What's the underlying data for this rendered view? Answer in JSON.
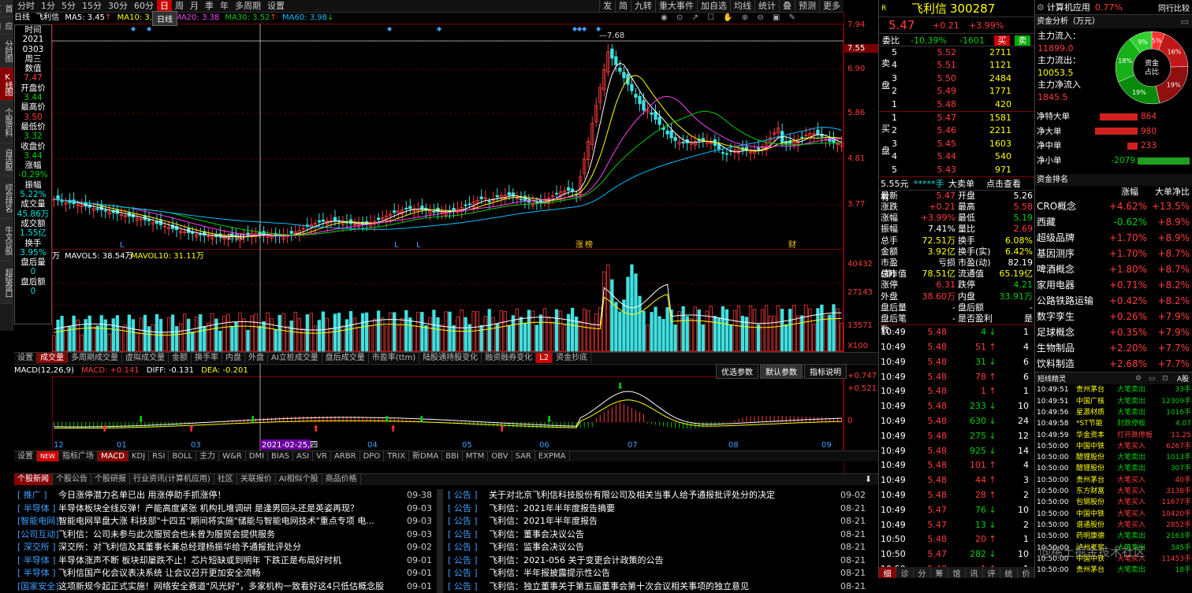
{
  "left_tabs": [
    "首页",
    "应用",
    "分时图",
    "K线图",
    "个股资料",
    "自选股",
    "综合排名",
    "牛叉诊股",
    "超级盘口"
  ],
  "left_tabs_active": 3,
  "periods": [
    "分时",
    "1分",
    "5分",
    "15分",
    "30分",
    "60分",
    "日",
    "周",
    "月",
    "季",
    "年",
    "多周期",
    "设置"
  ],
  "period_active": "日",
  "toolbar_right": [
    "发",
    "简",
    "九转",
    "重大事件",
    "加自选",
    "均线",
    "统计",
    "叠",
    "预测",
    "更多"
  ],
  "ma_line": {
    "label": "日线",
    "name": "飞利信",
    "ma5": "MA5: 3.45",
    "ma10": "MA10: 3.27",
    "ma20": "MA20: 3.38",
    "ma30": "MA30: 3.52",
    "ma60": "MA60: 3.98"
  },
  "tooltip": "日线",
  "infobox": [
    {
      "k": "时间",
      "v": "2021",
      "c": "wh"
    },
    {
      "k": "",
      "v": "0303",
      "c": "wh"
    },
    {
      "k": "",
      "v": "周三",
      "c": "wh"
    },
    {
      "k": "数值",
      "v": "7.47",
      "c": "red"
    },
    {
      "k": "开盘价",
      "v": "3.44",
      "c": "green"
    },
    {
      "k": "最高价",
      "v": "3.50",
      "c": "red"
    },
    {
      "k": "最低价",
      "v": "3.32",
      "c": "green"
    },
    {
      "k": "收盘价",
      "v": "3.44",
      "c": "green"
    },
    {
      "k": "涨幅",
      "v": "-0.29%",
      "c": "green"
    },
    {
      "k": "振幅",
      "v": "5.22%",
      "c": "cy"
    },
    {
      "k": "成交量",
      "v": "45.86万",
      "c": "cy"
    },
    {
      "k": "成交额",
      "v": "1.55亿",
      "c": "cy"
    },
    {
      "k": "换手",
      "v": "3.95%",
      "c": "cy"
    },
    {
      "k": "盘后量",
      "v": "0",
      "c": "cy"
    },
    {
      "k": "盘后额",
      "v": "0",
      "c": "cy"
    }
  ],
  "price_axis": [
    "7.94",
    "7.55",
    "6.90",
    "5.86",
    "4.81",
    "3.77"
  ],
  "price_hi_label": "7.68",
  "price_lo_label": "2.98",
  "chart_markers": [
    "L",
    "L",
    "L",
    "涨",
    "榜",
    "财"
  ],
  "vol_line": {
    "unit": "万",
    "mavol5": "MAVOL5: 38.54万",
    "mavol10": "MAVOL10: 31.11万"
  },
  "vol_axis": [
    "40432",
    "27143",
    "13571",
    "X100"
  ],
  "ind_tabs1": [
    "设置",
    "成交量",
    "多周期成交量",
    "虚拟成交量",
    "金额",
    "换手率",
    "内盘",
    "外盘",
    "AI立桩成交量",
    "盘后成交量",
    "市盈率(ttm)",
    "陆股通持股变化",
    "融资融券变化",
    "L2",
    "资金抄底"
  ],
  "ind_tabs1_active": 1,
  "macd_line": {
    "label": "MACD(12,26,9)",
    "macd": "MACD: +0.141",
    "diff": "DIFF: -0.131",
    "dea": "DEA: -0.201"
  },
  "macd_buttons": [
    "优选参数",
    "默认参数",
    "指标说明"
  ],
  "macd_axis": [
    "+0.747",
    "+0.521",
    "0"
  ],
  "date_axis": [
    "12",
    "01",
    "03",
    "04",
    "05",
    "06",
    "07",
    "08",
    "09"
  ],
  "date_cursor": "2021-02-25,四",
  "ind_tabs2": [
    "设置",
    "NEW",
    "指标广场",
    "MACD",
    "KDJ",
    "RSI",
    "BOLL",
    "主力",
    "W&R",
    "DMI",
    "BIAS",
    "ASI",
    "VR",
    "ARBR",
    "DPO",
    "TRIX",
    "新DMA",
    "BBI",
    "MTM",
    "OBV",
    "SAR",
    "EXPMA"
  ],
  "ind_tabs2_active": 3,
  "news_tabs": [
    "个股新闻",
    "个股公告",
    "个股研报",
    "行业资讯(计算机应用)",
    "社区",
    "关联报价",
    "AI相似个股",
    "商品价格"
  ],
  "news_left": [
    {
      "tag": "[ 推广 ]",
      "title": "今日涨停潜力名单已出 用涨停助手抓涨停！",
      "date": "09-38"
    },
    {
      "tag": "[ 半导体 ]",
      "title": "半导体板块全线反弹！产能高度紧张 机构扎堆调研 是逢男回头还是英姿再现？",
      "date": "09-03"
    },
    {
      "tag": "[智能电网]",
      "title": "智能电网旱盘大涨  科技部\"十四五\"期间将实施\"储能与智能电网技术\"重点专项  电...",
      "date": "09-03"
    },
    {
      "tag": "[公司互动]",
      "title": "飞利信：公司未参与此次服贸会也未曾为服贸会提供服务",
      "date": "09-03"
    },
    {
      "tag": "[ 深交所 ]",
      "title": "深交所：对飞利信及其董事长兼总经理杨振华给予通报批评处分",
      "date": "09-02"
    },
    {
      "tag": "[ 半导体 ]",
      "title": "半导体涨声不断 板块却屡跌不止！芯片短缺或到明年 下跌正是布局好时机",
      "date": "09-01"
    },
    {
      "tag": "[ 半导体 ]",
      "title": "飞利信国产化会议表决系统 让会议召开更加安全流畅",
      "date": "09-01"
    },
    {
      "tag": "[国家安全]",
      "title": "这项新规今起正式实施！网络安全赛道\"风光好\"，多家机构一致看好这4只低估概念股",
      "date": "09-01"
    }
  ],
  "news_right": [
    {
      "tag": "[ 公告 ]",
      "title": "关于对北京飞利信科技股份有限公司及相关当事人给予通报批评处分的决定",
      "date": "09-02"
    },
    {
      "tag": "[ 公告 ]",
      "title": "飞利信：2021年半年度报告摘要",
      "date": "08-21"
    },
    {
      "tag": "[ 公告 ]",
      "title": "飞利信：2021年半年度报告",
      "date": "08-21"
    },
    {
      "tag": "[ 公告 ]",
      "title": "飞利信：董事会决议公告",
      "date": "08-21"
    },
    {
      "tag": "[ 公告 ]",
      "title": "飞利信：监事会决议公告",
      "date": "08-21"
    },
    {
      "tag": "[ 公告 ]",
      "title": "飞利信：2021-056 关于变更会计政策的公告",
      "date": "08-21"
    },
    {
      "tag": "[ 公告 ]",
      "title": "飞利信：半年报披露提示性公告",
      "date": "08-21"
    },
    {
      "tag": "[ 公告 ]",
      "title": "飞利信：独立董事关于第五届董事会第十次会议相关事项的独立意见",
      "date": "08-21"
    }
  ],
  "quote": {
    "r": "R",
    "name": "飞利信",
    "code": "300287",
    "price": "5.47",
    "change": "+0.21",
    "pct": "+3.99%",
    "weibi_label": "委比",
    "weibi": "-10.39%",
    "weicha": "-1601",
    "buy_btn": "买",
    "sell_btn": "卖",
    "sell": [
      {
        "n": "5",
        "p": "5.52",
        "v": "2711"
      },
      {
        "n": "4",
        "p": "5.51",
        "v": "1121"
      },
      {
        "n": "3",
        "p": "5.50",
        "v": "2484"
      },
      {
        "n": "2",
        "p": "5.49",
        "v": "1771"
      },
      {
        "n": "1",
        "p": "5.48",
        "v": "420"
      }
    ],
    "buy": [
      {
        "n": "1",
        "p": "5.47",
        "v": "1581"
      },
      {
        "n": "2",
        "p": "5.46",
        "v": "2211"
      },
      {
        "n": "3",
        "p": "5.45",
        "v": "1603"
      },
      {
        "n": "4",
        "p": "5.44",
        "v": "540"
      },
      {
        "n": "5",
        "p": "5.43",
        "v": "971"
      }
    ],
    "sell_label": [
      "卖",
      "盘"
    ],
    "buy_label": [
      "买",
      "盘"
    ],
    "bigorder": {
      "a": "5.55元有",
      "b": "*****手",
      "c": "大卖单",
      "d": "点击查看"
    },
    "stats": [
      {
        "k1": "最新",
        "v1": "5.47",
        "c1": "red",
        "k2": "开盘",
        "v2": "5.26",
        "c2": "wh"
      },
      {
        "k1": "涨跌",
        "v1": "+0.21",
        "c1": "red",
        "k2": "最高",
        "v2": "5.58",
        "c2": "red"
      },
      {
        "k1": "涨幅",
        "v1": "+3.99%",
        "c1": "red",
        "k2": "最低",
        "v2": "5.19",
        "c2": "green"
      },
      {
        "k1": "振幅",
        "v1": "7.41%",
        "c1": "wh",
        "k2": "量比",
        "v2": "2.69",
        "c2": "red"
      },
      {
        "k1": "总手",
        "v1": "72.51万",
        "c1": "yel",
        "k2": "换手",
        "v2": "6.08%",
        "c2": "yel"
      },
      {
        "k1": "金额",
        "v1": "3.92亿",
        "c1": "yel",
        "k2": "换手(实)",
        "v2": "6.42%",
        "c2": "yel"
      },
      {
        "k1": "市盈(静)",
        "v1": "亏损",
        "c1": "wh",
        "k2": "市盈(动)",
        "v2": "82.19",
        "c2": "wh"
      },
      {
        "k1": "总市值",
        "v1": "78.51亿",
        "c1": "yel",
        "k2": "流通值",
        "v2": "65.19亿",
        "c2": "yel"
      },
      {
        "k1": "涨停",
        "v1": "6.31",
        "c1": "red",
        "k2": "跌停",
        "v2": "4.21",
        "c2": "green"
      },
      {
        "k1": "外盘",
        "v1": "38.60万",
        "c1": "red",
        "k2": "内盘",
        "v2": "33.91万",
        "c2": "green"
      },
      {
        "k1": "盘后量",
        "v1": "-",
        "c1": "wh",
        "k2": "盘后额",
        "v2": "-",
        "c2": "wh"
      },
      {
        "k1": "盘后笔数",
        "v1": "-",
        "c1": "wh",
        "k2": "是否盈利",
        "v2": "是",
        "c2": "wh"
      }
    ],
    "ticks": [
      {
        "t": "10:49",
        "p": "5.48",
        "v": "4",
        "d": "dn",
        "n": "1"
      },
      {
        "t": "10:49",
        "p": "5.48",
        "v": "51",
        "d": "up",
        "n": "4"
      },
      {
        "t": "10:49",
        "p": "5.48",
        "v": "31",
        "d": "dn",
        "n": "6"
      },
      {
        "t": "10:49",
        "p": "5.48",
        "v": "78",
        "d": "up",
        "n": "6"
      },
      {
        "t": "10:49",
        "p": "5.48",
        "v": "1",
        "d": "up",
        "n": "1"
      },
      {
        "t": "10:49",
        "p": "5.48",
        "v": "233",
        "d": "dn",
        "n": "10"
      },
      {
        "t": "10:49",
        "p": "5.48",
        "v": "630",
        "d": "dn",
        "n": "24"
      },
      {
        "t": "10:49",
        "p": "5.48",
        "v": "275",
        "d": "dn",
        "n": "12"
      },
      {
        "t": "10:49",
        "p": "5.48",
        "v": "925",
        "d": "dn",
        "n": "14"
      },
      {
        "t": "10:49",
        "p": "5.48",
        "v": "101",
        "d": "up",
        "n": "4"
      },
      {
        "t": "10:49",
        "p": "5.48",
        "v": "44",
        "d": "up",
        "n": "3"
      },
      {
        "t": "10:49",
        "p": "5.48",
        "v": "28",
        "d": "up",
        "n": "2"
      },
      {
        "t": "10:49",
        "p": "5.47",
        "v": "76",
        "d": "dn",
        "n": "10"
      },
      {
        "t": "10:49",
        "p": "5.47",
        "v": "13",
        "d": "dn",
        "n": "2"
      },
      {
        "t": "10:50",
        "p": "5.48",
        "v": "20",
        "d": "up",
        "n": "1"
      },
      {
        "t": "10:50",
        "p": "5.47",
        "v": "282",
        "d": "dn",
        "n": "10"
      },
      {
        "t": "10:50",
        "p": "5.48",
        "v": "1",
        "d": "up",
        "n": "1"
      }
    ],
    "bottom_tabs": [
      "细",
      "诊",
      "分",
      "筹",
      "馆",
      "讯",
      "评",
      "统",
      "价"
    ]
  },
  "rpanel": {
    "sector": "计算机应用",
    "sector_pct": "0.77%",
    "sector_link": "同行比较",
    "fund_title": "资金分析（万元）",
    "inflow_label": "主力流入：",
    "inflow": "11899.0",
    "outflow_label": "主力流出：",
    "outflow": "10053.5",
    "net_label": "主力净流入",
    "net": "1845.5",
    "donut_center": [
      "资金",
      "占比"
    ],
    "donut": [
      {
        "v": 5,
        "label": "5%",
        "color": "#ff3030"
      },
      {
        "v": 16,
        "label": "16%",
        "color": "#c01818"
      },
      {
        "v": 19,
        "label": "19%",
        "color": "#901010"
      },
      {
        "v": 19,
        "label": "19%",
        "color": "#0a8a0a"
      },
      {
        "v": 18,
        "label": "18%",
        "color": "#18b018"
      },
      {
        "v": 9,
        "label": "9%",
        "color": "#30d030"
      }
    ],
    "orders": [
      {
        "k": "净特大单",
        "v": "864",
        "w": 0.42,
        "c": "#d02020"
      },
      {
        "k": "净大单",
        "v": "980",
        "w": 0.47,
        "c": "#d02020"
      },
      {
        "k": "净中单",
        "v": "233",
        "w": 0.11,
        "c": "#d02020"
      },
      {
        "k": "净小单",
        "v": "-2079",
        "w": 1.0,
        "c": "#20a020"
      }
    ],
    "rank_title": "资金排名",
    "rank_cols": [
      "涨幅",
      "大单净比"
    ],
    "rank": [
      {
        "n": "CRO概念",
        "a": "+4.62%",
        "b": "+13.5%",
        "ac": "red"
      },
      {
        "n": "西藏",
        "a": "-0.62%",
        "b": "+8.9%",
        "ac": "green"
      },
      {
        "n": "超级品牌",
        "a": "+1.70%",
        "b": "+8.9%",
        "ac": "red"
      },
      {
        "n": "基因测序",
        "a": "+1.70%",
        "b": "+8.7%",
        "ac": "red"
      },
      {
        "n": "啤酒概念",
        "a": "+1.80%",
        "b": "+8.7%",
        "ac": "red"
      },
      {
        "n": "家用电器",
        "a": "+0.71%",
        "b": "+8.2%",
        "ac": "red"
      },
      {
        "n": "公路铁路运输",
        "a": "+0.42%",
        "b": "+8.2%",
        "ac": "red"
      },
      {
        "n": "数字孪生",
        "a": "+0.26%",
        "b": "+7.9%",
        "ac": "red"
      },
      {
        "n": "足球概念",
        "a": "+0.35%",
        "b": "+7.9%",
        "ac": "red"
      },
      {
        "n": "生物制品",
        "a": "+2.20%",
        "b": "+7.7%",
        "ac": "red"
      },
      {
        "n": "饮料制造",
        "a": "+2.68%",
        "b": "+7.7%",
        "ac": "red"
      }
    ],
    "sprite_title": "短线精灵",
    "sprite_sel": "A股",
    "sprites": [
      {
        "t": "10:49:51",
        "n": "贵州茅台",
        "e": "大笔卖出",
        "v": "33手",
        "c": "green"
      },
      {
        "t": "10:49:51",
        "n": "中国广核",
        "e": "大笔卖出",
        "v": "12309手",
        "c": "green"
      },
      {
        "t": "10:49:56",
        "n": "星源材质",
        "e": "大笔卖出",
        "v": "1016手",
        "c": "green"
      },
      {
        "t": "10:49:58",
        "n": "*ST节能",
        "e": "封跌停板",
        "v": "4.07",
        "c": "green"
      },
      {
        "t": "10:49:59",
        "n": "华金资本",
        "e": "打开跌停板",
        "v": "11.25",
        "c": "red"
      },
      {
        "t": "10:50:00",
        "n": "中国中铁",
        "e": "大笔买入",
        "v": "6267手",
        "c": "red"
      },
      {
        "t": "10:50:00",
        "n": "醋锂股份",
        "e": "大笔卖出",
        "v": "1013手",
        "c": "green"
      },
      {
        "t": "10:50:00",
        "n": "醋锂股份",
        "e": "大笔卖出",
        "v": "307手",
        "c": "green"
      },
      {
        "t": "10:50:00",
        "n": "贵州茅台",
        "e": "大笔买入",
        "v": "40手",
        "c": "red"
      },
      {
        "t": "10:50:00",
        "n": "东方财富",
        "e": "大笔买入",
        "v": "3138手",
        "c": "red"
      },
      {
        "t": "10:50:00",
        "n": "包钢股份",
        "e": "大笔买入",
        "v": "11677手",
        "c": "red"
      },
      {
        "t": "10:50:00",
        "n": "中国中铁",
        "e": "大笔买入",
        "v": "10420手",
        "c": "red"
      },
      {
        "t": "10:50:00",
        "n": "谱通股份",
        "e": "大笔买入",
        "v": "2852手",
        "c": "red"
      },
      {
        "t": "10:50:00",
        "n": "药明康德",
        "e": "大笔卖出",
        "v": "2163手",
        "c": "green"
      },
      {
        "t": "10:50:00",
        "n": "泸州老窖",
        "e": "大笔卖出",
        "v": "345手",
        "c": "green"
      },
      {
        "t": "10:50:00",
        "n": "中国中铁",
        "e": "大笔买入",
        "v": "11453手",
        "c": "red"
      },
      {
        "t": "10:50:00",
        "n": "贵州茅台",
        "e": "大笔卖出",
        "v": "18手",
        "c": "green"
      }
    ]
  },
  "watermark": "@稀土掘金技术社区"
}
